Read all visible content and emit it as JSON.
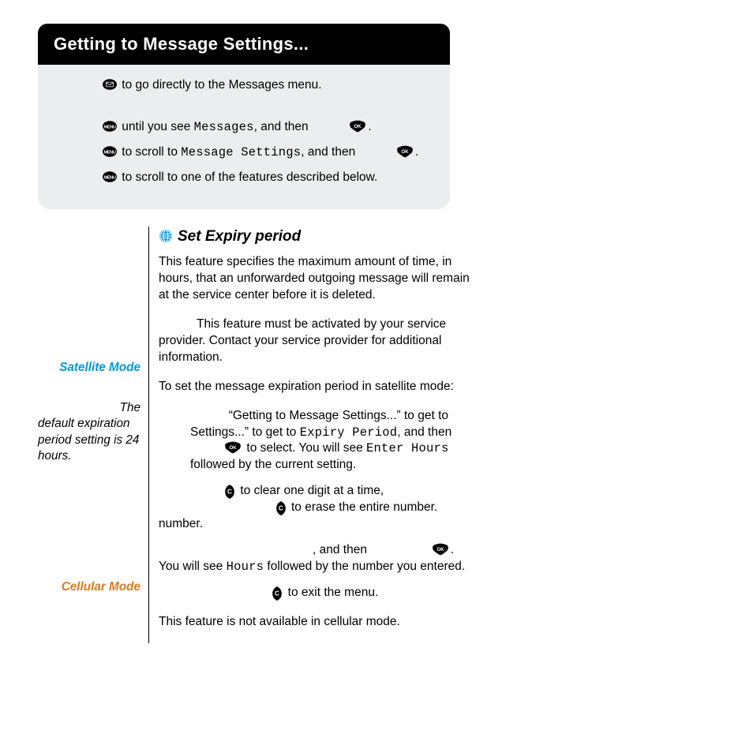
{
  "header": {
    "title": "Getting to Message Settings..."
  },
  "greybox": {
    "line1_after": " to go directly to the Messages menu.",
    "line2_pre": " until you see ",
    "line2_msg": "Messages",
    "line2_post": ", and then ",
    "line3_pre": " to scroll to ",
    "line3_msg": "Message Settings",
    "line3_post": ", and then ",
    "line4": " to scroll to one of the features described below."
  },
  "section": {
    "title": "Set Expiry period"
  },
  "sidebar": {
    "sat_label": "Satellite Mode",
    "note_first": "The",
    "note_rest": "default expiration period setting is 24 hours.",
    "cell_label": "Cellular Mode"
  },
  "main": {
    "p1": "This feature specifies the maximum amount of time, in hours, that an unforwarded outgoing message will remain at the service center before it is deleted.",
    "p2": "This feature must be activated by your service provider. Contact your service provider for additional information.",
    "p3": "To set the message expiration period in satellite mode:",
    "s1a": "“Getting to Message Settings...” to get to ",
    "s1_expiry": "Expiry Period",
    "s1b": ", and then ",
    "s1c": " to select. You will see ",
    "s1_enter": "Enter Hours",
    "s1d": " followed by the current setting.",
    "s2a": " to clear one digit at a time, ",
    "s2b": " to erase the entire number.",
    "s3a": ", and then ",
    "s3b": ". You will see ",
    "s3_hours": "Hours",
    "s3c": " followed by the number you entered.",
    "s4": " to exit the menu.",
    "cell": "This feature is not available in cellular mode."
  }
}
